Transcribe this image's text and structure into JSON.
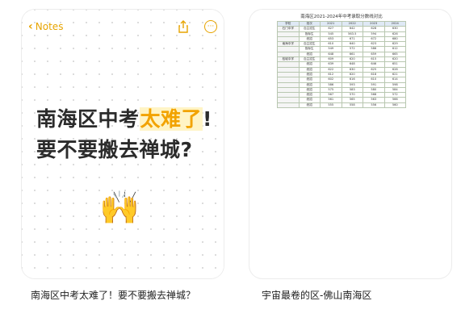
{
  "card1": {
    "back_label": "Notes",
    "headline_prefix": "南海区中考",
    "headline_highlight": "太难了",
    "headline_suffix": "!",
    "headline_line2": "要不要搬去禅城?",
    "emoji": "🙌"
  },
  "card2": {
    "table_title": "南海区2021-2024年中考录取分数线对比",
    "headers": [
      "学校",
      "批次",
      "2021",
      "2022",
      "2023",
      "2024"
    ],
    "rows": [
      [
        "石门中学",
        "自主招生",
        "627",
        "642",
        "628",
        "630"
      ],
      [
        "",
        "指标生",
        "545",
        "563.5",
        "594",
        "626"
      ],
      [
        "",
        "统招",
        "653",
        "671",
        "672",
        "680"
      ],
      [
        "南海中学",
        "自主招生",
        "610",
        "640",
        "623",
        "629"
      ],
      [
        "",
        "指标生",
        "549",
        "572",
        "586",
        "612"
      ],
      [
        "",
        "统招",
        "648",
        "661",
        "659",
        "665"
      ],
      [
        "桂城中学",
        "自主招生",
        "609",
        "620",
        "615",
        "620"
      ],
      [
        "",
        "统招",
        "639",
        "648",
        "646",
        "651"
      ],
      [
        "",
        "统招",
        "622",
        "630",
        "625",
        "628"
      ],
      [
        "",
        "统招",
        "612",
        "620",
        "618",
        "621"
      ],
      [
        "",
        "统招",
        "602",
        "616",
        "610",
        "614"
      ],
      [
        "",
        "统招",
        "586",
        "593",
        "591",
        "598"
      ],
      [
        "",
        "统招",
        "575",
        "583",
        "580",
        "584"
      ],
      [
        "",
        "统招",
        "567",
        "570",
        "568",
        "572"
      ],
      [
        "",
        "统招",
        "561",
        "565",
        "563",
        "566"
      ],
      [
        "",
        "统招",
        "555",
        "558",
        "556",
        "560"
      ]
    ]
  },
  "captions": {
    "left": "南海区中考太难了！要不要搬去禅城？",
    "right": "宇宙最卷的区-佛山南海区"
  },
  "colors": {
    "accent": "#e7a400",
    "highlight_bg": "#fff4c5"
  }
}
